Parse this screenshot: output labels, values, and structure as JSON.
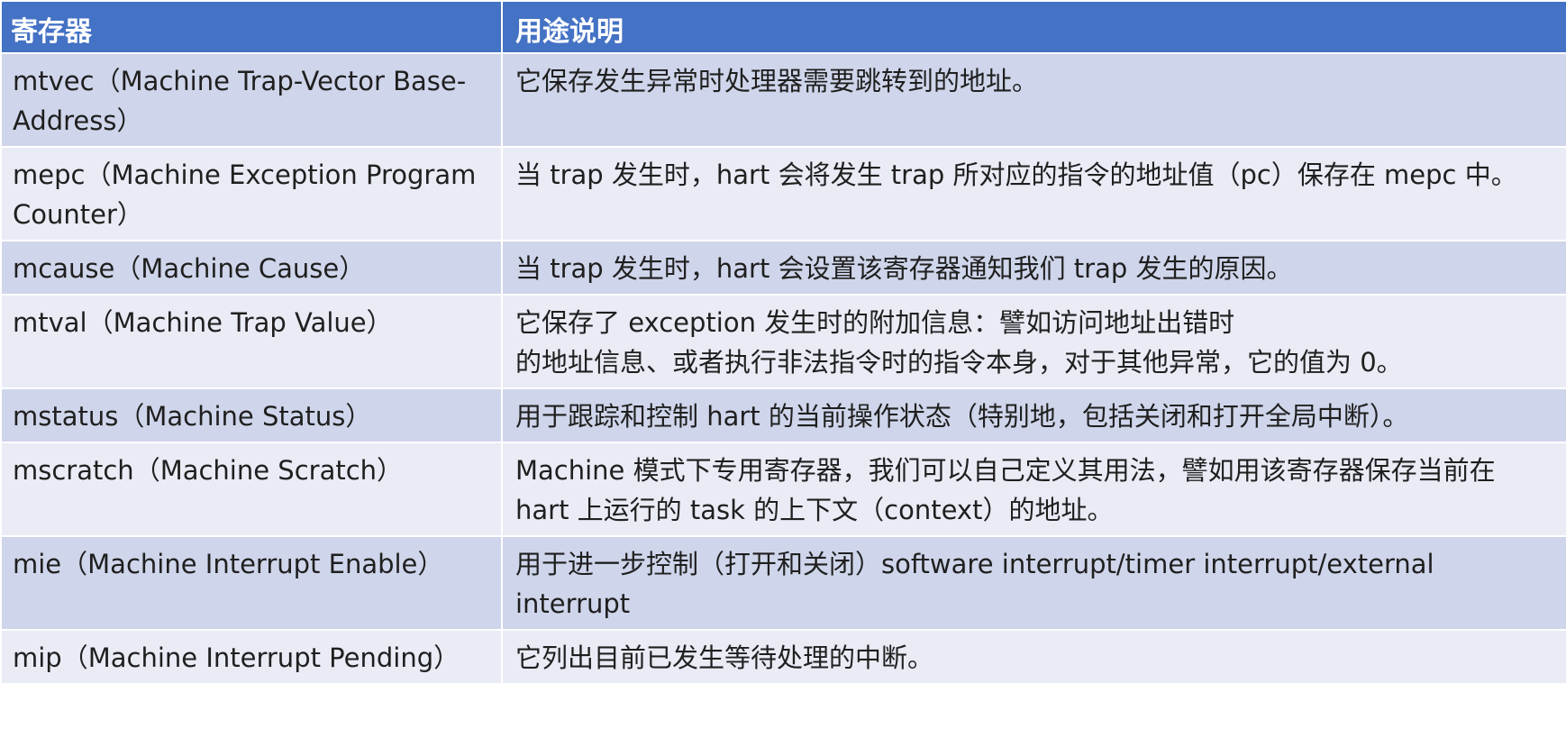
{
  "header": {
    "col1": "寄存器",
    "col2": "用途说明"
  },
  "rows": [
    {
      "register": "mtvec（Machine Trap-Vector Base-Address）",
      "description": [
        "它保存发生异常时处理器需要跳转到的地址。"
      ]
    },
    {
      "register": "mepc（Machine Exception Program Counter）",
      "description": [
        "当 trap 发生时，hart 会将发生 trap 所对应的指令的地址值（pc）保存在 mepc 中。"
      ]
    },
    {
      "register": "mcause（Machine Cause）",
      "description": [
        "当 trap 发生时，hart 会设置该寄存器通知我们 trap 发生的原因。"
      ]
    },
    {
      "register": "mtval（Machine Trap Value）",
      "description": [
        "它保存了 exception 发生时的附加信息：譬如访问地址出错时",
        "的地址信息、或者执行非法指令时的指令本身，对于其他异常，它的值为 0。"
      ]
    },
    {
      "register": "mstatus（Machine Status）",
      "description": [
        "用于跟踪和控制 hart 的当前操作状态（特别地，包括关闭和打开全局中断）。"
      ]
    },
    {
      "register": "mscratch（Machine Scratch）",
      "description": [
        "Machine 模式下专用寄存器，我们可以自己定义其用法，譬如用该寄存器保存当前在 hart 上运行的 task 的上下文（context）的地址。"
      ]
    },
    {
      "register": "mie（Machine Interrupt Enable）",
      "description": [
        "用于进一步控制（打开和关闭）software interrupt/timer interrupt/external interrupt"
      ]
    },
    {
      "register": "mip（Machine Interrupt Pending）",
      "description": [
        "它列出目前已发生等待处理的中断。"
      ]
    }
  ]
}
